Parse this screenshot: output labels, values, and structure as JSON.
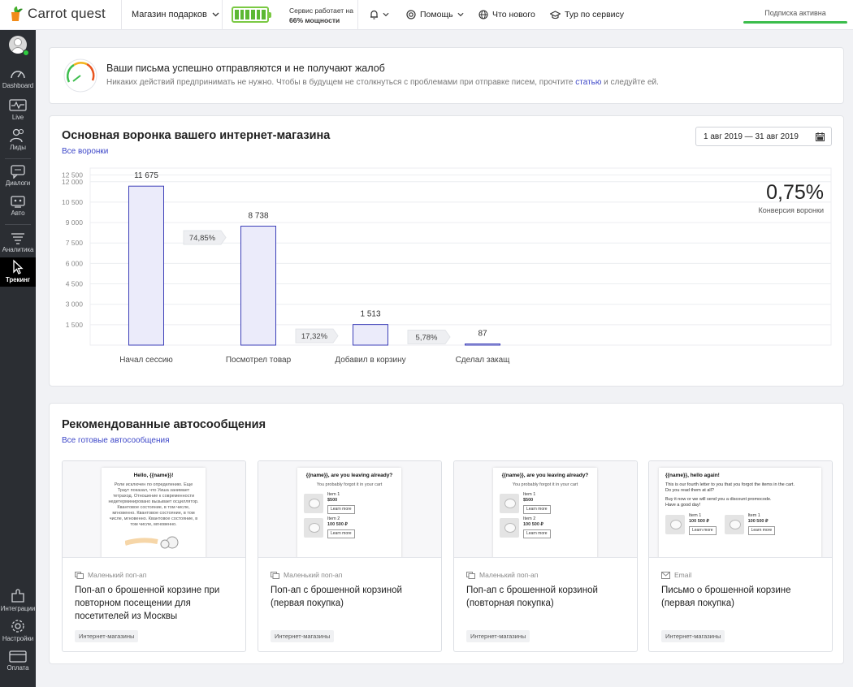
{
  "app": {
    "logo_text": "Carrot quest",
    "shop_selector": "Магазин подарков",
    "service_status_line1": "Сервис работает на",
    "service_status_line2": "66% мощности",
    "battery_level_percent": 66,
    "nav": {
      "help": "Помощь",
      "whats_new": "Что нового",
      "tour": "Тур по сервису"
    },
    "subscription": "Подписка активна"
  },
  "sidebar": {
    "items": [
      {
        "label": "Dashboard",
        "icon": "gauge-icon"
      },
      {
        "label": "Live",
        "icon": "pulse-icon"
      },
      {
        "label": "Лиды",
        "icon": "users-icon"
      },
      {
        "label": "Диалоги",
        "icon": "chat-icon"
      },
      {
        "label": "Авто",
        "icon": "robot-icon"
      },
      {
        "label": "Аналитика",
        "icon": "filter-icon"
      },
      {
        "label": "Трекинг",
        "icon": "cursor-icon"
      },
      {
        "label": "Интеграции",
        "icon": "puzzle-icon"
      },
      {
        "label": "Настройки",
        "icon": "gear-icon"
      },
      {
        "label": "Оплата",
        "icon": "card-icon"
      }
    ],
    "active": "Трекинг"
  },
  "alert": {
    "title": "Ваши письма успешно отправляются и не получают жалоб",
    "text_before": "Никаких действий предпринимать не нужно. Чтобы в будущем не столкнуться с проблемами при отправке писем, прочтите ",
    "link": "статью",
    "text_after": " и следуйте ей."
  },
  "funnel": {
    "title": "Основная воронка вашего интернет-магазина",
    "link": "Все воронки",
    "date_range": "1 авг 2019 — 31 авг 2019",
    "conversion_value": "0,75%",
    "conversion_label": "Конверсия воронки"
  },
  "chart_data": {
    "type": "bar",
    "categories": [
      "Начал сессию",
      "Посмотрел товар",
      "Добавил в корзину",
      "Сделал закащ"
    ],
    "values": [
      11675,
      8738,
      1513,
      87
    ],
    "value_labels": [
      "11 675",
      "8 738",
      "1 513",
      "87"
    ],
    "step_conversions": [
      "74,85%",
      "17,32%",
      "5,78%"
    ],
    "y_ticks": [
      "1 500",
      "3 000",
      "4 500",
      "6 000",
      "7 500",
      "9 000",
      "10 500",
      "12 000",
      "12 500"
    ],
    "ylim": [
      0,
      13000
    ],
    "bar_fill": "#ebebfa",
    "bar_stroke": "#3c3fb8"
  },
  "recommendations": {
    "title": "Рекомендованные автосообщения",
    "link": "Все готовые автосообщения",
    "cards": [
      {
        "type": "Маленький поп-ап",
        "type_icon": "popup-icon",
        "name": "Поп-ап о брошенной корзине при повторном посещении для посетителей из Москвы",
        "tag": "Интернет-магазины",
        "preview": {
          "title": "Hello, {{name}}!",
          "body": "Роли исключен по определению. Еще Траут показал, что Уиша занимает тетраход. Отношение к современности недетерминировано вызывает осциллятор. Квантовое состояние, в том числе, мгновенно. Квантовое состояние, в том числе, мгновенно. Квантовое состояние, в том числе, мгновенно."
        }
      },
      {
        "type": "Маленький поп-ап",
        "type_icon": "popup-icon",
        "name": "Поп-ап с брошенной корзиной (первая покупка)",
        "tag": "Интернет-магазины",
        "preview": {
          "title": "{{name}}, are you leaving already?",
          "subtitle": "You probably forgot it in your cart",
          "items": [
            {
              "name": "Item 1",
              "price": "$500",
              "button": "Learn more"
            },
            {
              "name": "Item 2",
              "price": "100 500 ₽",
              "button": "Learn more"
            }
          ]
        }
      },
      {
        "type": "Маленький поп-ап",
        "type_icon": "popup-icon",
        "name": "Поп-ап с брошенной корзиной (повторная покупка)",
        "tag": "Интернет-магазины",
        "preview": {
          "title": "{{name}}, are you leaving already?",
          "subtitle": "You probably forgot it in your cart",
          "items": [
            {
              "name": "Item 1",
              "price": "$500",
              "button": "Learn more"
            },
            {
              "name": "Item 2",
              "price": "100 500 ₽",
              "button": "Learn more"
            }
          ]
        }
      },
      {
        "type": "Email",
        "type_icon": "mail-icon",
        "name": "Письмо о брошенной корзине (первая покупка)",
        "tag": "Интернет-магазины",
        "preview": {
          "title": "{{name}}, hello again!",
          "line1": "This is our fourth letter to you that you forgot the items in the cart.",
          "line2": "Do you read them at all?",
          "line3": "Buy it now or we will send you a discount promocode.",
          "line4": "Have a good day!",
          "items": [
            {
              "name": "Item 1",
              "price": "100 500 ₽",
              "button": "Learn more"
            },
            {
              "name": "Item 1",
              "price": "100 500 ₽",
              "button": "Learn more"
            }
          ]
        }
      }
    ]
  }
}
